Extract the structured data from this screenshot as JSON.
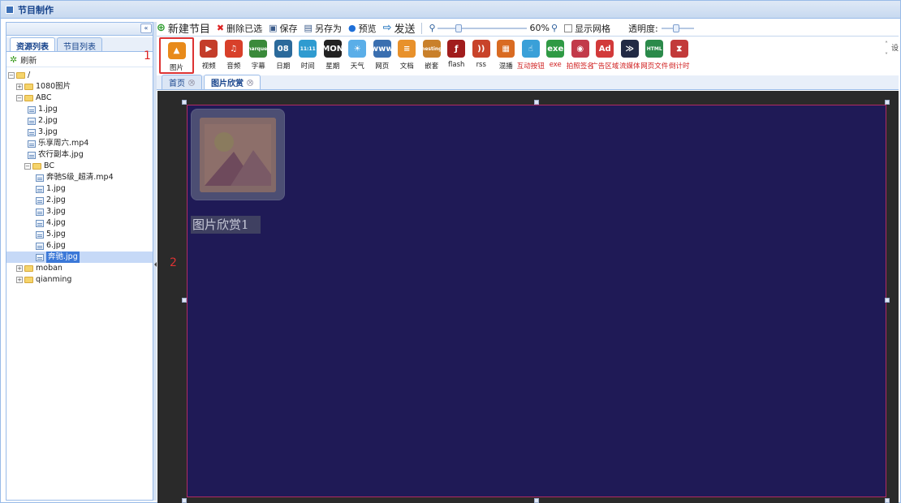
{
  "window": {
    "title": "节目制作"
  },
  "left_panel": {
    "tabs": [
      {
        "label": "资源列表",
        "active": true
      },
      {
        "label": "节目列表",
        "active": false
      }
    ],
    "refresh_label": "刷新",
    "tree": [
      {
        "label": "/",
        "level": 0,
        "kind": "folder",
        "expander": "−"
      },
      {
        "label": "1080图片",
        "level": 1,
        "kind": "folder",
        "expander": "+"
      },
      {
        "label": "ABC",
        "level": 1,
        "kind": "folder",
        "expander": "−"
      },
      {
        "label": "1.jpg",
        "level": 2,
        "kind": "file"
      },
      {
        "label": "2.jpg",
        "level": 2,
        "kind": "file"
      },
      {
        "label": "3.jpg",
        "level": 2,
        "kind": "file"
      },
      {
        "label": "乐享周六.mp4",
        "level": 2,
        "kind": "file"
      },
      {
        "label": "农行副本.jpg",
        "level": 2,
        "kind": "file"
      },
      {
        "label": "BC",
        "level": 2,
        "kind": "folder",
        "expander": "−"
      },
      {
        "label": "奔驰S级_超清.mp4",
        "level": 3,
        "kind": "file"
      },
      {
        "label": "1.jpg",
        "level": 3,
        "kind": "file"
      },
      {
        "label": "2.jpg",
        "level": 3,
        "kind": "file"
      },
      {
        "label": "3.jpg",
        "level": 3,
        "kind": "file"
      },
      {
        "label": "4.jpg",
        "level": 3,
        "kind": "file"
      },
      {
        "label": "5.jpg",
        "level": 3,
        "kind": "file"
      },
      {
        "label": "6.jpg",
        "level": 3,
        "kind": "file"
      },
      {
        "label": "奔驰.jpg",
        "level": 3,
        "kind": "file",
        "selected": true
      },
      {
        "label": "moban",
        "level": 1,
        "kind": "folder",
        "expander": "+"
      },
      {
        "label": "qianming",
        "level": 1,
        "kind": "folder",
        "expander": "+"
      }
    ]
  },
  "toolbar": {
    "new_program": "新建节目",
    "delete_selected": "删除已选",
    "save": "保存",
    "save_as": "另存为",
    "preview": "预览",
    "send": "发送",
    "zoom_value": "60%",
    "show_grid": "显示网格",
    "opacity_label": "透明度:",
    "cut_text": "设"
  },
  "tools": [
    {
      "label": "图片",
      "color": "#e88a1a",
      "glyph": "▲",
      "highlight": true
    },
    {
      "label": "视频",
      "color": "#c43d2a",
      "glyph": "▶"
    },
    {
      "label": "音频",
      "color": "#d8402a",
      "glyph": "♫"
    },
    {
      "label": "字幕",
      "color": "#3a8a3a",
      "glyph": "marquee"
    },
    {
      "label": "日期",
      "color": "#2b6a9b",
      "glyph": "08"
    },
    {
      "label": "时间",
      "color": "#2f9bd0",
      "glyph": "11:11"
    },
    {
      "label": "星期",
      "color": "#222222",
      "glyph": "MON"
    },
    {
      "label": "天气",
      "color": "#5aaee8",
      "glyph": "☀"
    },
    {
      "label": "网页",
      "color": "#3a6fb0",
      "glyph": "www"
    },
    {
      "label": "文档",
      "color": "#e8912b",
      "glyph": "≡"
    },
    {
      "label": "嵌套",
      "color": "#c9802a",
      "glyph": "nesting"
    },
    {
      "label": "flash",
      "color": "#a11d1d",
      "glyph": "ƒ"
    },
    {
      "label": "rss",
      "color": "#c8432a",
      "glyph": "))"
    },
    {
      "label": "混播",
      "color": "#d96b22",
      "glyph": "▦"
    },
    {
      "label": "互动按钮",
      "color": "#3aa0d8",
      "glyph": "☝",
      "red": true
    },
    {
      "label": "exe",
      "color": "#2f9a44",
      "glyph": "exe",
      "red": true
    },
    {
      "label": "拍照签名",
      "color": "#c23a4a",
      "glyph": "◉",
      "red": true
    },
    {
      "label": "广告区域",
      "color": "#d23a3a",
      "glyph": "Ad",
      "red": true
    },
    {
      "label": "流媒体",
      "color": "#222a44",
      "glyph": "≫",
      "red": true
    },
    {
      "label": "网页文件",
      "color": "#2b8a4a",
      "glyph": "HTML",
      "red": true
    },
    {
      "label": "倒计时",
      "color": "#c23a3a",
      "glyph": "⧗",
      "red": true
    }
  ],
  "doc_tabs": [
    {
      "label": "首页",
      "active": false
    },
    {
      "label": "图片欣赏",
      "active": true
    }
  ],
  "canvas": {
    "widget_caption": "图片欣赏1"
  },
  "annotations": {
    "label_1": "1",
    "label_2": "2"
  }
}
